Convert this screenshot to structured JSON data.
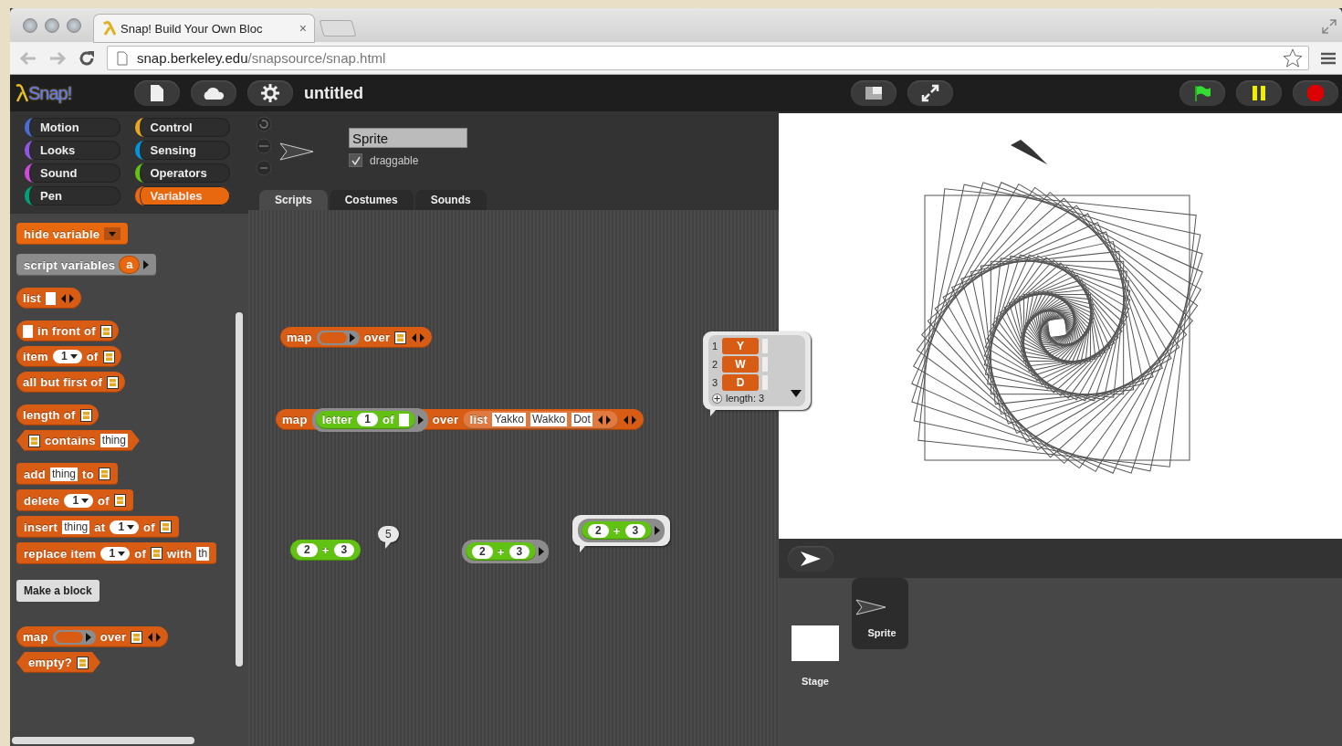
{
  "browser": {
    "tab_title": "Snap! Build Your Own Bloc",
    "tab_close": "×",
    "url_host": "snap.berkeley.edu",
    "url_path": "/snapsource/snap.html"
  },
  "app": {
    "logo": "Snap!",
    "project_title": "untitled"
  },
  "categories": [
    {
      "label": "Motion",
      "color": "#4a6cd4",
      "selected": false
    },
    {
      "label": "Control",
      "color": "#e6a822",
      "selected": false
    },
    {
      "label": "Looks",
      "color": "#8f56e3",
      "selected": false
    },
    {
      "label": "Sensing",
      "color": "#0494dc",
      "selected": false
    },
    {
      "label": "Sound",
      "color": "#cf4ad9",
      "selected": false
    },
    {
      "label": "Operators",
      "color": "#62c213",
      "selected": false
    },
    {
      "label": "Pen",
      "color": "#00a178",
      "selected": false
    },
    {
      "label": "Variables",
      "color": "#e8680f",
      "selected": true
    }
  ],
  "sprite": {
    "name": "Sprite",
    "draggable": {
      "label": "draggable",
      "checked": true
    }
  },
  "tabs": [
    {
      "label": "Scripts",
      "selected": true
    },
    {
      "label": "Costumes",
      "selected": false
    },
    {
      "label": "Sounds",
      "selected": false
    }
  ],
  "palette": {
    "groups": [
      [
        {
          "kind": "block",
          "block": {
            "kind": "command",
            "color": "#e8680f",
            "parts": [
              {
                "kind": "word",
                "v": "hide variable"
              },
              {
                "kind": "dropdown"
              }
            ]
          }
        },
        {
          "kind": "block",
          "block": {
            "kind": "command",
            "color": "#8c8c8c",
            "parts": [
              {
                "kind": "word",
                "v": "script variables"
              },
              {
                "kind": "variable",
                "v": "a"
              },
              {
                "kind": "arrow"
              }
            ]
          }
        }
      ],
      [
        {
          "kind": "block",
          "block": {
            "kind": "reporter",
            "color": "#d95c14",
            "parts": [
              {
                "kind": "word",
                "v": "list"
              },
              {
                "kind": "empty"
              },
              {
                "kind": "arrows"
              }
            ]
          }
        }
      ],
      [
        {
          "kind": "block",
          "block": {
            "kind": "reporter",
            "color": "#d95c14",
            "parts": [
              {
                "kind": "empty"
              },
              {
                "kind": "word",
                "v": "in front of"
              },
              {
                "kind": "list"
              }
            ]
          }
        },
        {
          "kind": "block",
          "block": {
            "kind": "reporter",
            "color": "#d95c14",
            "parts": [
              {
                "kind": "word",
                "v": "item"
              },
              {
                "kind": "numdd",
                "v": "1"
              },
              {
                "kind": "word",
                "v": "of"
              },
              {
                "kind": "list"
              }
            ]
          }
        },
        {
          "kind": "block",
          "block": {
            "kind": "reporter",
            "color": "#d95c14",
            "parts": [
              {
                "kind": "word",
                "v": "all but first of"
              },
              {
                "kind": "list"
              }
            ]
          }
        }
      ],
      [
        {
          "kind": "block",
          "block": {
            "kind": "reporter",
            "color": "#d95c14",
            "parts": [
              {
                "kind": "word",
                "v": "length of"
              },
              {
                "kind": "list"
              }
            ]
          }
        },
        {
          "kind": "block",
          "block": {
            "kind": "predicate",
            "color": "#d95c14",
            "parts": [
              {
                "kind": "list"
              },
              {
                "kind": "word",
                "v": "contains"
              },
              {
                "kind": "text",
                "v": "thing"
              }
            ]
          }
        }
      ],
      [
        {
          "kind": "block",
          "block": {
            "kind": "command",
            "color": "#d95c14",
            "parts": [
              {
                "kind": "word",
                "v": "add"
              },
              {
                "kind": "text",
                "v": "thing"
              },
              {
                "kind": "word",
                "v": "to"
              },
              {
                "kind": "list"
              }
            ]
          }
        },
        {
          "kind": "block",
          "block": {
            "kind": "command",
            "color": "#d95c14",
            "parts": [
              {
                "kind": "word",
                "v": "delete"
              },
              {
                "kind": "numdd",
                "v": "1"
              },
              {
                "kind": "word",
                "v": "of"
              },
              {
                "kind": "list"
              }
            ]
          }
        },
        {
          "kind": "block",
          "block": {
            "kind": "command",
            "color": "#d95c14",
            "parts": [
              {
                "kind": "word",
                "v": "insert"
              },
              {
                "kind": "text",
                "v": "thing"
              },
              {
                "kind": "word",
                "v": "at"
              },
              {
                "kind": "numdd",
                "v": "1"
              },
              {
                "kind": "word",
                "v": "of"
              },
              {
                "kind": "list"
              }
            ]
          }
        },
        {
          "kind": "block",
          "block": {
            "kind": "command",
            "color": "#d95c14",
            "parts": [
              {
                "kind": "word",
                "v": "replace item"
              },
              {
                "kind": "numdd",
                "v": "1"
              },
              {
                "kind": "word",
                "v": "of"
              },
              {
                "kind": "list"
              },
              {
                "kind": "word",
                "v": "with"
              },
              {
                "kind": "text",
                "v": "th"
              }
            ]
          }
        }
      ],
      [
        {
          "kind": "button",
          "label": "Make a block"
        }
      ],
      [
        {
          "kind": "block",
          "block": {
            "kind": "reporter",
            "color": "#d95c14",
            "parts": [
              {
                "kind": "word",
                "v": "map"
              },
              {
                "kind": "ring"
              },
              {
                "kind": "word",
                "v": "over"
              },
              {
                "kind": "list"
              },
              {
                "kind": "arrows"
              }
            ]
          }
        },
        {
          "kind": "block",
          "block": {
            "kind": "predicate",
            "color": "#d95c14",
            "parts": [
              {
                "kind": "word",
                "v": "empty?"
              },
              {
                "kind": "list"
              }
            ]
          }
        }
      ]
    ]
  },
  "scripts": [
    {
      "block": {
        "kind": "reporter",
        "color": "#d95c14",
        "parts": [
          {
            "kind": "word",
            "v": "map"
          },
          {
            "kind": "ring"
          },
          {
            "kind": "word",
            "v": "over"
          },
          {
            "kind": "list"
          },
          {
            "kind": "arrows"
          }
        ]
      }
    },
    {
      "block": {
        "kind": "reporter",
        "color": "#d95c14",
        "parts": [
          {
            "kind": "word",
            "v": "map"
          },
          {
            "kind": "ring",
            "block": {
              "kind": "reporter",
              "color": "#62c213",
              "parts": [
                {
                  "kind": "word",
                  "v": "letter"
                },
                {
                  "kind": "num",
                  "v": "1"
                },
                {
                  "kind": "word",
                  "v": "of"
                },
                {
                  "kind": "empty"
                }
              ]
            }
          },
          {
            "kind": "word",
            "v": "over"
          },
          {
            "kind": "block",
            "block": {
              "kind": "reporter",
              "color": "#e07a40",
              "parts": [
                {
                  "kind": "word",
                  "v": "list"
                },
                {
                  "kind": "text",
                  "v": "Yakko"
                },
                {
                  "kind": "text",
                  "v": "Wakko"
                },
                {
                  "kind": "text",
                  "v": "Dot"
                },
                {
                  "kind": "arrows"
                }
              ]
            }
          },
          {
            "kind": "arrows"
          }
        ]
      },
      "result": {
        "kind": "list",
        "rows": [
          {
            "index": "1",
            "value": "Y"
          },
          {
            "index": "2",
            "value": "W"
          },
          {
            "index": "3",
            "value": "D"
          }
        ],
        "length": "length: 3"
      }
    },
    {
      "block": {
        "kind": "reporter",
        "color": "#62c213",
        "parts": [
          {
            "kind": "num",
            "v": "2"
          },
          {
            "kind": "word",
            "v": "+"
          },
          {
            "kind": "num",
            "v": "3"
          }
        ]
      },
      "result": {
        "kind": "value",
        "value": "5"
      }
    },
    {
      "block": {
        "kind": "ring",
        "block": {
          "kind": "reporter",
          "color": "#62c213",
          "parts": [
            {
              "kind": "num",
              "v": "2"
            },
            {
              "kind": "word",
              "v": "+"
            },
            {
              "kind": "num",
              "v": "3"
            }
          ]
        }
      },
      "result": {
        "kind": "ring",
        "block": {
          "kind": "reporter",
          "color": "#62c213",
          "parts": [
            {
              "kind": "num",
              "v": "2"
            },
            {
              "kind": "word",
              "v": "+"
            },
            {
              "kind": "num",
              "v": "3"
            }
          ]
        }
      }
    }
  ],
  "corral": {
    "stage_label": "Stage",
    "sprites": [
      {
        "name": "Sprite",
        "selected": true
      }
    ]
  }
}
